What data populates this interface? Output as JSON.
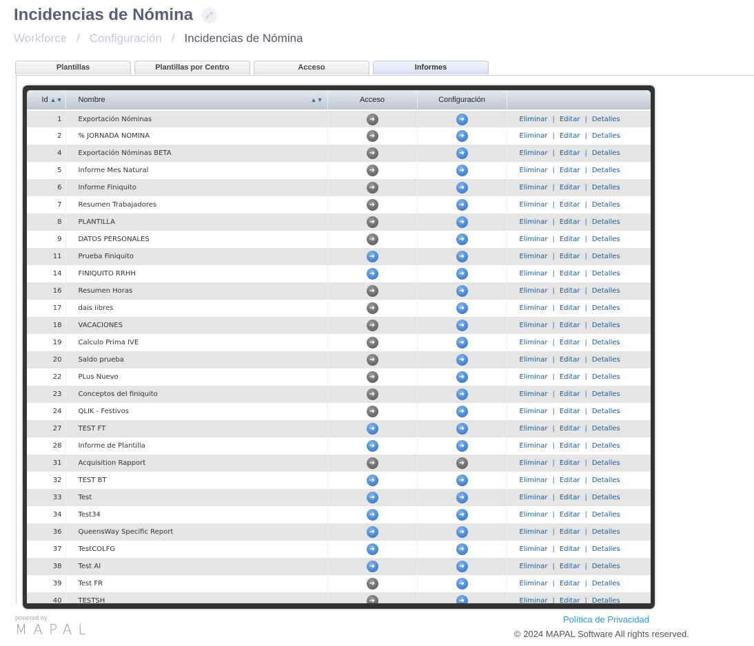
{
  "header": {
    "title": "Incidencias de Nómina",
    "expand_icon": "expand-icon"
  },
  "breadcrumb": [
    "Workforce",
    "Configuración",
    "Incidencias de Nómina"
  ],
  "tabs": [
    {
      "label": "Plantillas"
    },
    {
      "label": "Plantillas por Centro"
    },
    {
      "label": "Acceso"
    },
    {
      "label": "Informes",
      "active": true
    }
  ],
  "table": {
    "columns": [
      "Id",
      "Nombre",
      "Acceso",
      "Configuración"
    ],
    "actions": {
      "delete": "Eliminar",
      "edit": "Editar",
      "details": "Detalles",
      "separator": "|"
    },
    "icon_colors": {
      "blue": "#2c6cc2",
      "gray": "#505050"
    },
    "rows": [
      {
        "id": "1",
        "name": "Exportación Nóminas",
        "acceso": "gray",
        "config": "blue"
      },
      {
        "id": "2",
        "name": "% JORNADA NOMINA",
        "acceso": "gray",
        "config": "blue"
      },
      {
        "id": "4",
        "name": "Exportación Nóminas BETA",
        "acceso": "gray",
        "config": "blue"
      },
      {
        "id": "5",
        "name": "Informe Mes Natural",
        "acceso": "gray",
        "config": "blue"
      },
      {
        "id": "6",
        "name": "Informe Finiquito",
        "acceso": "gray",
        "config": "blue"
      },
      {
        "id": "7",
        "name": "Resumen Trabajadores",
        "acceso": "gray",
        "config": "blue"
      },
      {
        "id": "8",
        "name": "PLANTILLA",
        "acceso": "gray",
        "config": "blue"
      },
      {
        "id": "9",
        "name": "DATOS PERSONALES",
        "acceso": "gray",
        "config": "blue"
      },
      {
        "id": "11",
        "name": "Prueba Finiquito",
        "acceso": "blue",
        "config": "blue"
      },
      {
        "id": "14",
        "name": "FINIQUITO RRHH",
        "acceso": "blue",
        "config": "blue"
      },
      {
        "id": "16",
        "name": "Resumen Horas",
        "acceso": "gray",
        "config": "blue"
      },
      {
        "id": "17",
        "name": "dais iibres",
        "acceso": "gray",
        "config": "blue"
      },
      {
        "id": "18",
        "name": "VACACIONES",
        "acceso": "gray",
        "config": "blue"
      },
      {
        "id": "19",
        "name": "Calculo Prima IVE",
        "acceso": "gray",
        "config": "blue"
      },
      {
        "id": "20",
        "name": "Saldo prueba",
        "acceso": "gray",
        "config": "blue"
      },
      {
        "id": "22",
        "name": "PLus Nuevo",
        "acceso": "gray",
        "config": "blue"
      },
      {
        "id": "23",
        "name": "Conceptos del finiquito",
        "acceso": "gray",
        "config": "blue"
      },
      {
        "id": "24",
        "name": "QLIK - Festivos",
        "acceso": "gray",
        "config": "blue"
      },
      {
        "id": "27",
        "name": "TEST FT",
        "acceso": "blue",
        "config": "blue"
      },
      {
        "id": "28",
        "name": "Informe de Plantilla",
        "acceso": "blue",
        "config": "blue"
      },
      {
        "id": "31",
        "name": "Acquisition Rapport",
        "acceso": "gray",
        "config": "gray"
      },
      {
        "id": "32",
        "name": "TEST BT",
        "acceso": "blue",
        "config": "blue"
      },
      {
        "id": "33",
        "name": "Test",
        "acceso": "blue",
        "config": "blue"
      },
      {
        "id": "34",
        "name": "Test34",
        "acceso": "blue",
        "config": "blue"
      },
      {
        "id": "36",
        "name": "QueensWay Specific Report",
        "acceso": "blue",
        "config": "blue"
      },
      {
        "id": "37",
        "name": "TestCOLFG",
        "acceso": "blue",
        "config": "blue"
      },
      {
        "id": "38",
        "name": "Test Al",
        "acceso": "blue",
        "config": "blue"
      },
      {
        "id": "39",
        "name": "Test FR",
        "acceso": "gray",
        "config": "blue"
      },
      {
        "id": "40",
        "name": "TESTSH",
        "acceso": "gray",
        "config": "blue"
      }
    ]
  },
  "footer": {
    "powered_by": "powered by",
    "logo": "MAPAL",
    "privacy": "Política de Privacidad",
    "copyright": "© 2024 MAPAL Software All rights reserved."
  }
}
